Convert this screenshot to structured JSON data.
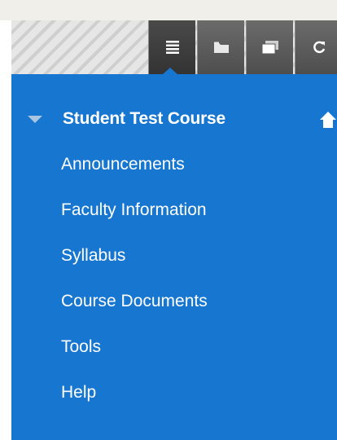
{
  "toolbar": {
    "icons": [
      "menu-list-icon",
      "folder-icon",
      "window-icon",
      "refresh-icon"
    ],
    "active_index": 0
  },
  "menu": {
    "course_title": "Student Test Course",
    "items": [
      {
        "label": "Announcements"
      },
      {
        "label": "Faculty Information"
      },
      {
        "label": "Syllabus"
      },
      {
        "label": "Course Documents"
      },
      {
        "label": "Tools"
      },
      {
        "label": "Help"
      }
    ]
  },
  "colors": {
    "menu_bg": "#1776d0",
    "toolbar_button": "#585858",
    "text": "#ffffff"
  }
}
